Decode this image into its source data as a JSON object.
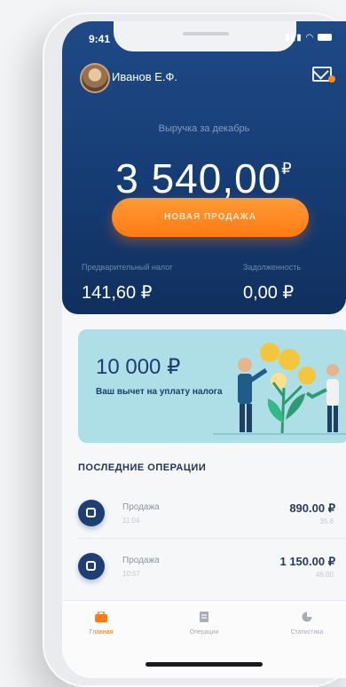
{
  "status": {
    "time": "9:41"
  },
  "user": {
    "name": "Иванов Е.Ф."
  },
  "revenue": {
    "label": "Выручка за декабрь",
    "amount": "3 540,00",
    "currency": "₽"
  },
  "cta": {
    "label": "НОВАЯ ПРОДАЖА"
  },
  "stats": {
    "advance_label": "Предварительный налог",
    "advance_value": "141,60 ₽",
    "debt_label": "Задолженность",
    "debt_value": "0,00 ₽"
  },
  "banner": {
    "amount": "10 000 ₽",
    "text": "Ваш вычет на уплату налога"
  },
  "operations": {
    "title": "ПОСЛЕДНИЕ ОПЕРАЦИИ",
    "items": [
      {
        "title": "Продажа",
        "subtitle": "11:04",
        "amount": "890.00",
        "currency": "₽",
        "sub_amount": "35.6"
      },
      {
        "title": "Продажа",
        "subtitle": "10:57",
        "amount": "1 150.00",
        "currency": "₽",
        "sub_amount": "46.00"
      }
    ]
  },
  "tabs": [
    {
      "label": "Главная",
      "icon": "briefcase-icon",
      "color": "#ff7a12",
      "active": true
    },
    {
      "label": "Операции",
      "icon": "receipt-icon",
      "color": "#a8adb8",
      "active": false
    },
    {
      "label": "Статистика",
      "icon": "pie-chart-icon",
      "color": "#a8adb8",
      "active": false
    }
  ],
  "colors": {
    "header": "#1a427b",
    "accent": "#ff7a12",
    "banner": "#aedfe6"
  }
}
